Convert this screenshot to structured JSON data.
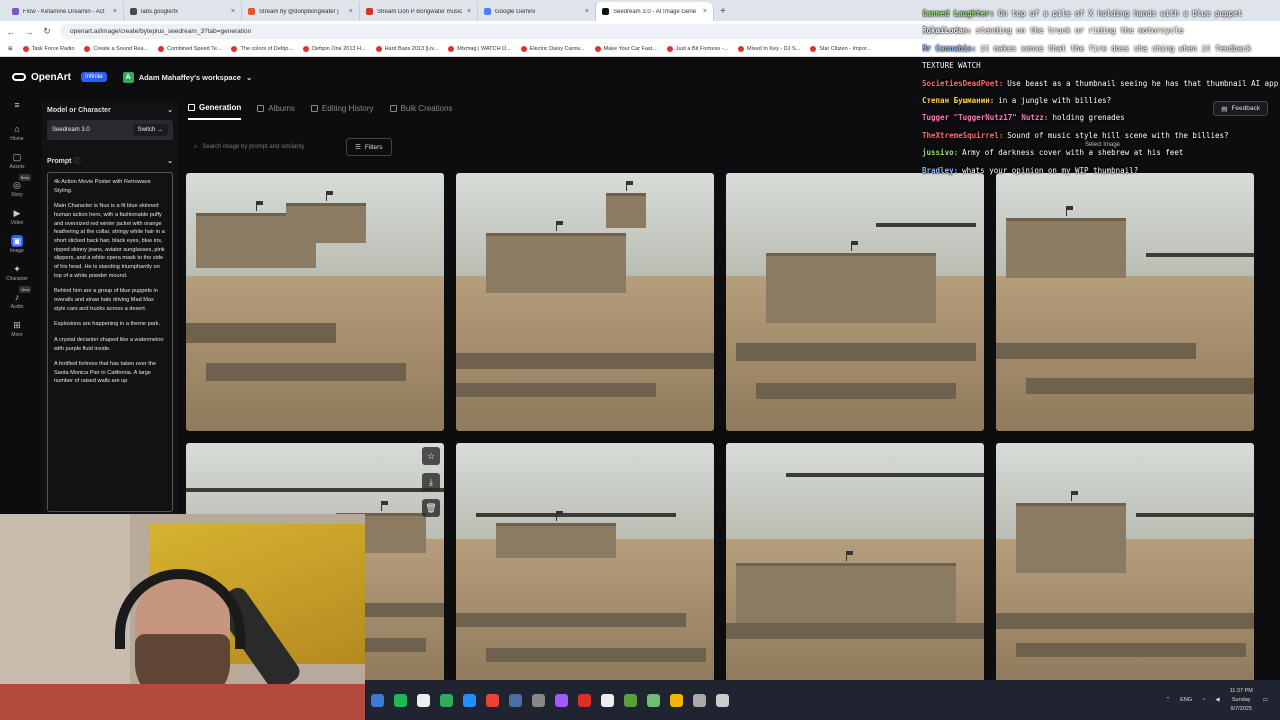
{
  "browser": {
    "tabs": [
      {
        "label": "Flow - Ketamine Dreamin - Act",
        "color": "#7b57d1",
        "active": false
      },
      {
        "label": "labs.google/fx",
        "color": "#4a4a4a",
        "active": false
      },
      {
        "label": "Stream by @donpbongwater |",
        "color": "#e8562a",
        "active": false
      },
      {
        "label": "Stream Don P Bongwater music",
        "color": "#d93025",
        "active": false
      },
      {
        "label": "Google Gemini",
        "color": "#4d7ef7",
        "active": false
      },
      {
        "label": "Seedream 3.0 - AI Image Gene",
        "color": "#111111",
        "active": true
      }
    ],
    "address": "openart.ai/image/create/byteplus_seedream_3?tab=generation",
    "bookmarks": [
      "Task Force Radio",
      "Create a Sound Rea...",
      "Combined Speed Te...",
      "The colors of Defqo...",
      "Defqon One 2013 H...",
      "Hard Bass 2013 [Liv...",
      "Mixmag | WATCH D...",
      "Electric Daisy Carniv...",
      "Make Your Car Fast...",
      "Just a Bit Fortress -...",
      "Mixed In Key - DJ S...",
      "Star Citizen - Impor..."
    ]
  },
  "app": {
    "brand": "OpenArt",
    "plan_badge": "Infinite",
    "workspace_initial": "A",
    "workspace": "Adam Mahaffey's workspace"
  },
  "rail": [
    {
      "label": "Home",
      "icon": "home-icon",
      "glyph": "⌂"
    },
    {
      "label": "Assets",
      "icon": "assets-icon",
      "glyph": "▢"
    },
    {
      "label": "Story",
      "icon": "story-icon",
      "glyph": "◎",
      "pill": "Beta"
    },
    {
      "label": "Video",
      "icon": "video-icon",
      "glyph": "▶"
    },
    {
      "label": "Image",
      "icon": "image-icon",
      "glyph": "▣",
      "active": true
    },
    {
      "label": "Character",
      "icon": "character-icon",
      "glyph": "✦"
    },
    {
      "label": "Audio",
      "icon": "audio-icon",
      "glyph": "♪",
      "pill": "New"
    },
    {
      "label": "More",
      "icon": "more-icon",
      "glyph": "⊞"
    }
  ],
  "panel": {
    "model_heading": "Model or Character",
    "model_name": "Seedream 3.0",
    "switch_label": "Switch",
    "prompt_heading": "Prompt",
    "prompt_paragraphs": [
      "4k Action Movie Poster with Retrowave Styling.",
      "Main Character is Nux is a fit blue skinned human action hero, with a fashionable puffy and oversized red winter jacket with orange feathering at the collar, stringy white hair in a short slicked back hair, black eyes, blue iris, ripped skinny jeans, aviator sunglasses, pink slippers, and a white opera mask to the side of his head. He is standing triumphantly on top of a white powder mound.",
      "Behind him are a group of blue puppets in overalls and straw hats driving Mad Max style cars and trucks across a desert.",
      "Explosions are happening in a theme park.",
      "A crystal decanter shaped like a watermelon with purple fluid inside.",
      "A fortified fortress that has taken over the Santa Monica Pier in California. A large number of raised walls are up"
    ]
  },
  "main": {
    "tabs": [
      "Generation",
      "Albums",
      "Editing History",
      "Bulk Creations"
    ],
    "search_placeholder": "Search image by prompt and similarity",
    "filters_label": "Filters",
    "feedback_label": "Feedback",
    "select_label": "Select Image"
  },
  "chat": [
    {
      "name": "Canned Laughter:",
      "color": "#9be07a",
      "msg": "On top of a pile of X holding hands with a blue puppet"
    },
    {
      "name": "RokaiLodan:",
      "color": "#f2f2f2",
      "msg": "standing on the truck or riding the motorcycle"
    },
    {
      "name": "Mr Cannabis:",
      "color": "#8fb8ff",
      "msg": "it makes sense that the fire does cha ching when it feedback"
    },
    {
      "name": "",
      "color": "#ffffff",
      "msg": "TEXTURE WATCH"
    },
    {
      "name": "SocietiesDeadPoet:",
      "color": "#ff6b6b",
      "msg": "Use beast as a thumbnail seeing he has that thumbnail AI app"
    },
    {
      "name": "Степан Бушманин:",
      "color": "#ffd34d",
      "msg": "in a jungle with billies?"
    },
    {
      "name": "Tugger \"TuggerNutz17\" Nutzz:",
      "color": "#ff7ab8",
      "msg": "holding grenades"
    },
    {
      "name": "TheXtremeSquirrel:",
      "color": "#ff6b6b",
      "msg": "Sound of music style hill scene with the billies?"
    },
    {
      "name": "jussivo:",
      "color": "#9be07a",
      "msg": "Army of darkness cover with a shebrew at his feet"
    },
    {
      "name": "Bradley:",
      "color": "#8fb8ff",
      "msg": "whats your opinion on my WIP thumbnail?"
    }
  ],
  "taskbar": {
    "lang": "ENG",
    "time": "11:37 PM",
    "day": "Sunday",
    "date": "9/7/2025",
    "app_colors": [
      "#3a7bd5",
      "#1db954",
      "#eee",
      "#2eab5b",
      "#1e90ff",
      "#ea4335",
      "#4a6fa5",
      "#888",
      "#a259ff",
      "#d93025",
      "#eee",
      "#5b9f3a",
      "#6fbf73",
      "#f4b400",
      "#aaa",
      "#ccc"
    ]
  }
}
